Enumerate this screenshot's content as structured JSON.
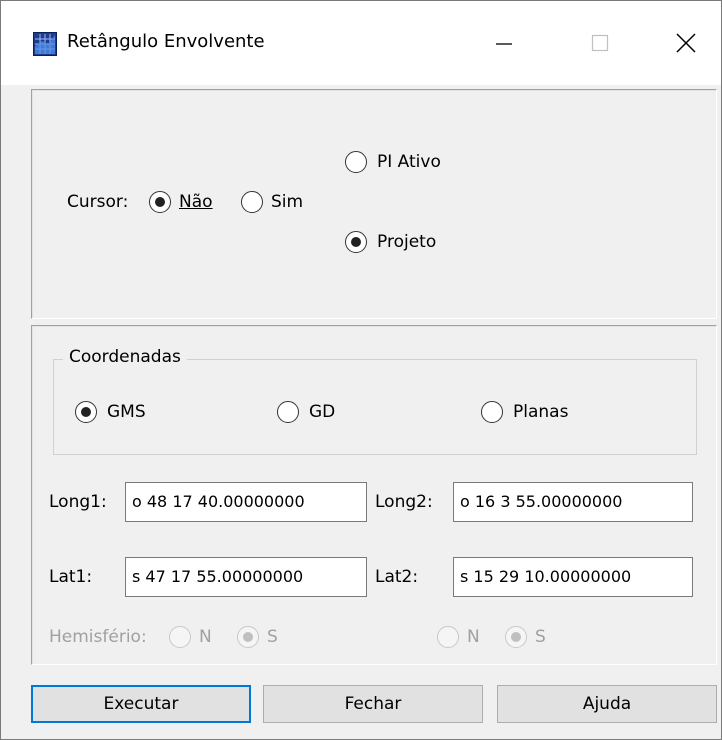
{
  "window": {
    "title": "Retângulo Envolvente",
    "icon": "grid-chart-icon",
    "controls": {
      "minimize": "minimize-icon",
      "maximize": "maximize-icon",
      "close": "close-icon"
    }
  },
  "cursor": {
    "label": "Cursor:",
    "options": [
      {
        "label": "Não",
        "selected": true
      },
      {
        "label": "Sim",
        "selected": false
      }
    ],
    "source_options": [
      {
        "label": "PI Ativo",
        "selected": false
      },
      {
        "label": "Projeto",
        "selected": true
      }
    ]
  },
  "coordinates": {
    "group_label": "Coordenadas",
    "options": [
      {
        "label": "GMS",
        "selected": true
      },
      {
        "label": "GD",
        "selected": false
      },
      {
        "label": "Planas",
        "selected": false
      }
    ]
  },
  "fields": {
    "long1": {
      "label": "Long1:",
      "value": "o 48 17 40.00000000"
    },
    "long2": {
      "label": "Long2:",
      "value": "o 16 3 55.00000000"
    },
    "lat1": {
      "label": "Lat1:",
      "value": "s 47 17 55.00000000"
    },
    "lat2": {
      "label": "Lat2:",
      "value": "s 15 29 10.00000000"
    }
  },
  "hemisphere": {
    "label": "Hemisfério:",
    "left": [
      {
        "label": "N",
        "selected": false
      },
      {
        "label": "S",
        "selected": true
      }
    ],
    "right": [
      {
        "label": "N",
        "selected": false
      },
      {
        "label": "S",
        "selected": true
      }
    ],
    "enabled": false
  },
  "buttons": {
    "execute": "Executar",
    "close": "Fechar",
    "help": "Ajuda"
  },
  "colors": {
    "accent": "#0078d7",
    "disabled_text": "#a0a0a0"
  }
}
